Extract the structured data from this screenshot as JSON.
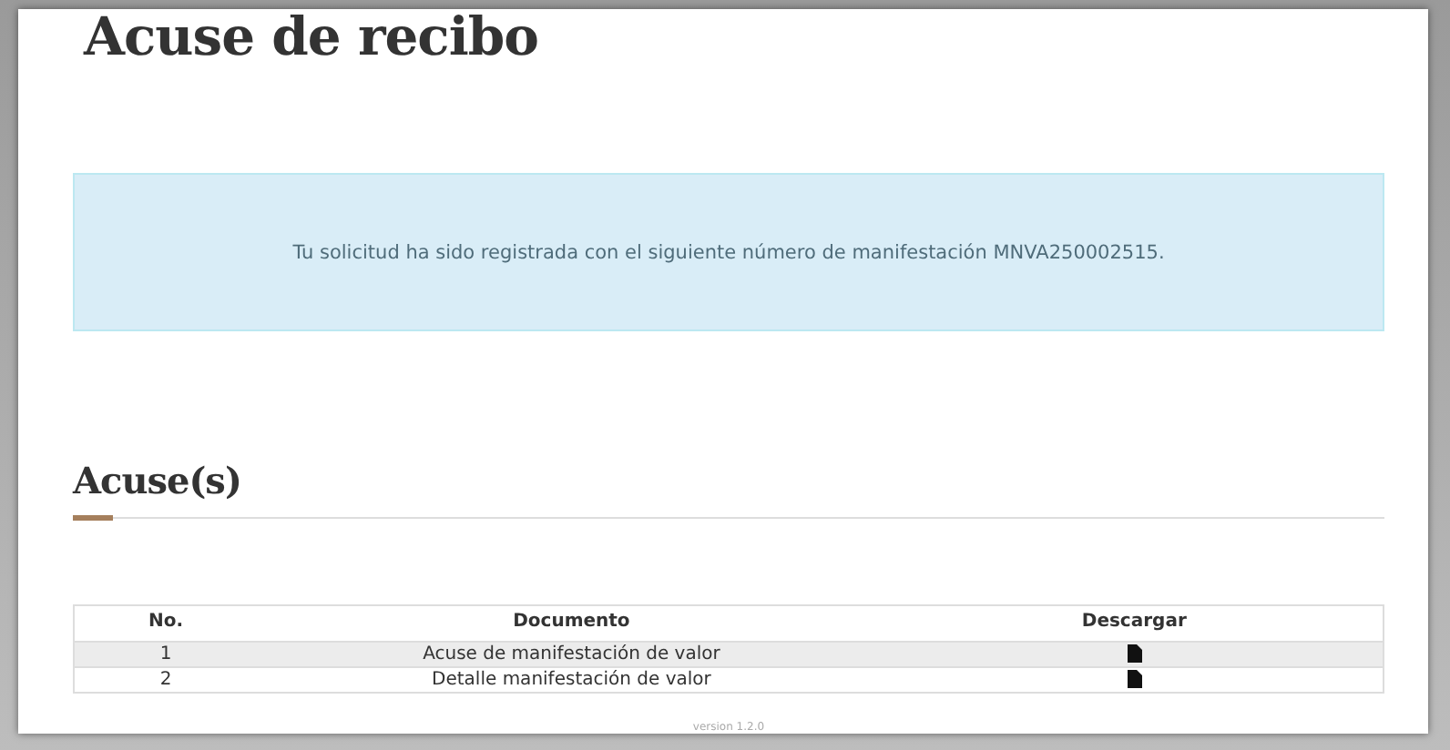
{
  "title": "Acuse de recibo",
  "alert": {
    "message": "Tu solicitud ha sido registrada con el siguiente número de manifestación MNVA250002515."
  },
  "section_title": "Acuse(s)",
  "table": {
    "columns": [
      "No.",
      "Documento",
      "Descargar"
    ],
    "rows": [
      {
        "number": "1",
        "document": "Acuse de manifestación de valor"
      },
      {
        "number": "2",
        "document": "Detalle manifestación de valor"
      }
    ]
  },
  "version": "version 1.2.0"
}
